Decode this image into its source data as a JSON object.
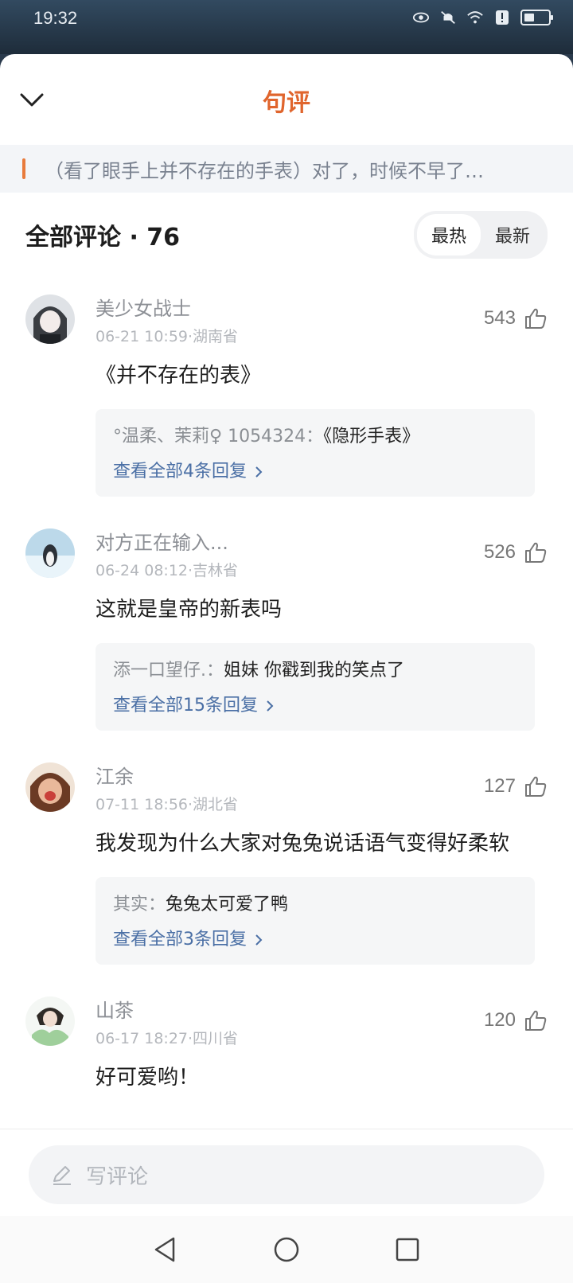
{
  "status_bar": {
    "time": "19:32"
  },
  "header": {
    "title": "句评"
  },
  "quote": {
    "text": "（看了眼手上并不存在的手表）对了，时候不早了…"
  },
  "comments_header": {
    "title": "全部评论 · 76",
    "sort_hot": "最热",
    "sort_new": "最新"
  },
  "comments": [
    {
      "name": "美少女战士",
      "meta": "06-21 10:59·湖南省",
      "likes": "543",
      "text": "《并不存在的表》",
      "reply_user": "°温柔、茉莉♀ 1054324：",
      "reply_text": "《隐形手表》",
      "reply_more": "查看全部4条回复"
    },
    {
      "name": "对方正在输入...",
      "meta": "06-24 08:12·吉林省",
      "likes": "526",
      "text": "这就是皇帝的新表吗",
      "reply_user": "添一口望仔.：",
      "reply_text": "姐妹 你戳到我的笑点了",
      "reply_more": "查看全部15条回复"
    },
    {
      "name": "江余",
      "meta": "07-11 18:56·湖北省",
      "likes": "127",
      "text": "我发现为什么大家对兔兔说话语气变得好柔软",
      "reply_user": "其实：",
      "reply_text": "兔兔太可爱了鸭",
      "reply_more": "查看全部3条回复"
    },
    {
      "name": "山茶",
      "meta": "06-17 18:27·四川省",
      "likes": "120",
      "text": "好可爱哟！"
    }
  ],
  "composer": {
    "placeholder": "写评论"
  },
  "colors": {
    "accent": "#e0652d",
    "link": "#4a6fa5"
  },
  "icons": [
    "chevron-down-icon",
    "thumb-up-icon",
    "pencil-icon",
    "chevron-right-icon",
    "back-triangle-icon",
    "home-circle-icon",
    "recents-square-icon"
  ]
}
